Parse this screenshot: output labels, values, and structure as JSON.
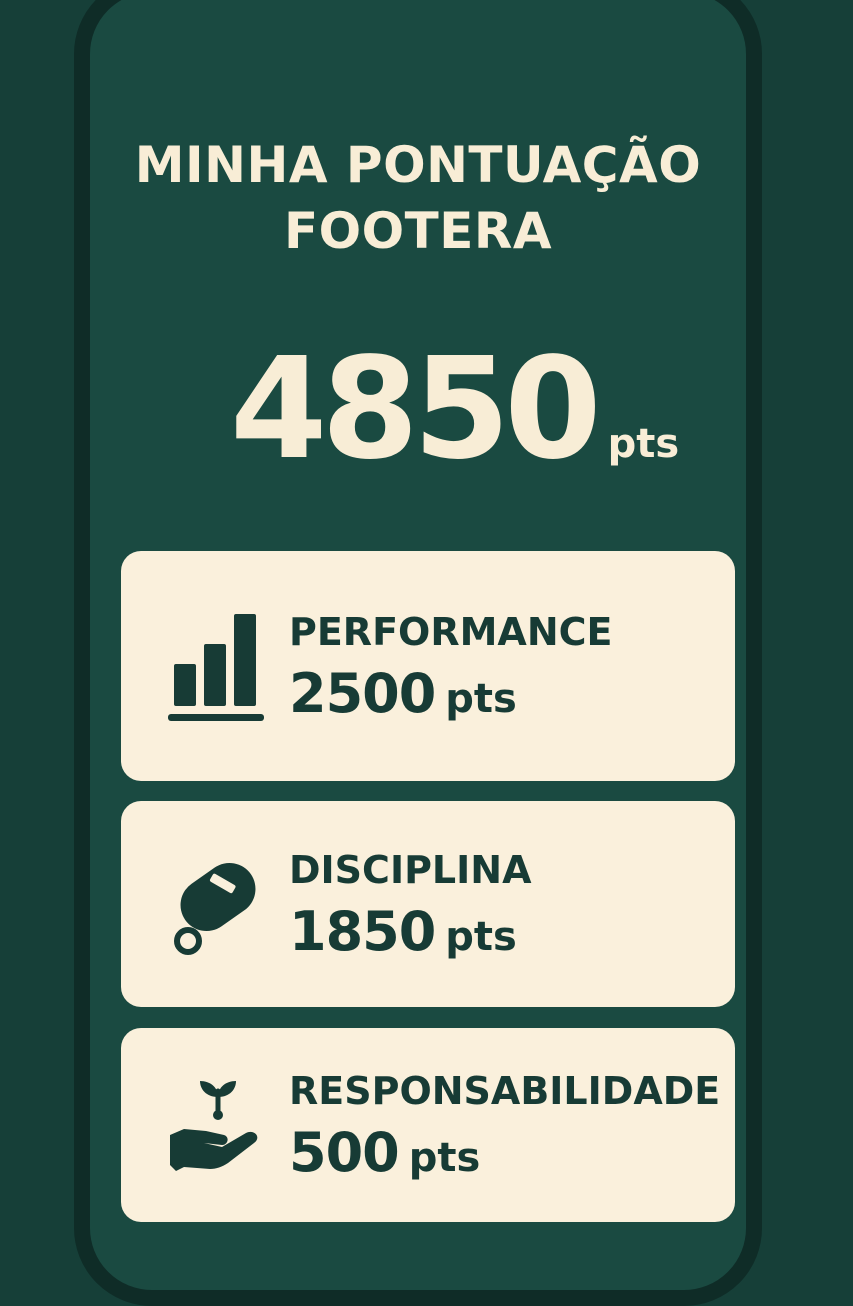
{
  "header": {
    "title_line1": "MINHA PONTUAÇÃO",
    "title_line2": "FOOTERA"
  },
  "total": {
    "value": "4850",
    "unit": "pts"
  },
  "categories": [
    {
      "label": "PERFORMANCE",
      "points": "2500",
      "unit": "pts",
      "icon": "bar-chart-icon"
    },
    {
      "label": "DISCIPLINA",
      "points": "1850",
      "unit": "pts",
      "icon": "whistle-icon"
    },
    {
      "label": "RESPONSABILIDADE",
      "points": "500",
      "unit": "pts",
      "icon": "hand-sprout-icon"
    }
  ],
  "colors": {
    "background": "#163f38",
    "card": "#faf0dc",
    "text_light": "#f8edd6",
    "text_dark": "#173b35"
  }
}
